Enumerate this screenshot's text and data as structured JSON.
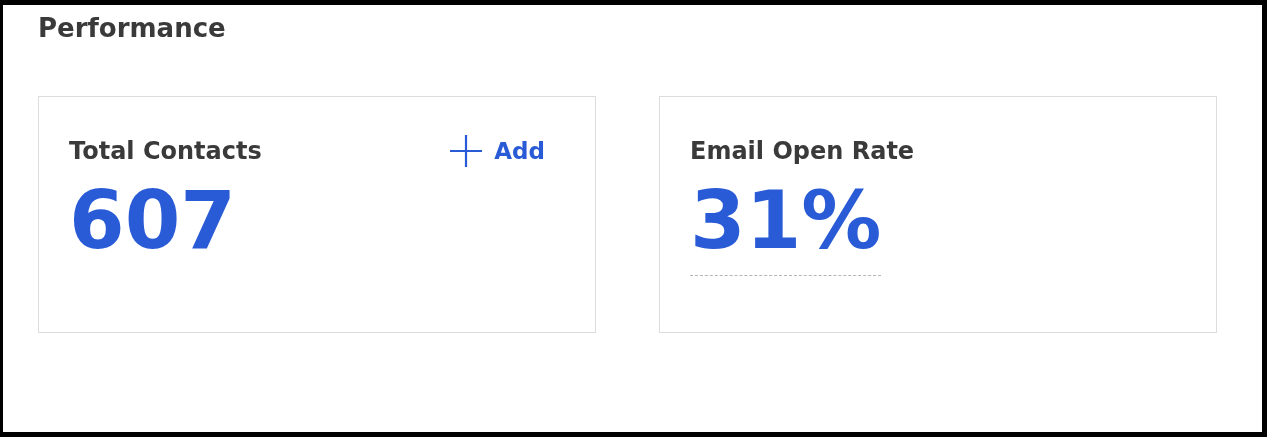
{
  "title": "Performance",
  "cards": [
    {
      "title": "Total Contacts",
      "value": "607",
      "underlined": false,
      "action": {
        "label": "Add"
      }
    },
    {
      "title": "Email Open Rate",
      "value": "31%",
      "underlined": true
    }
  ]
}
